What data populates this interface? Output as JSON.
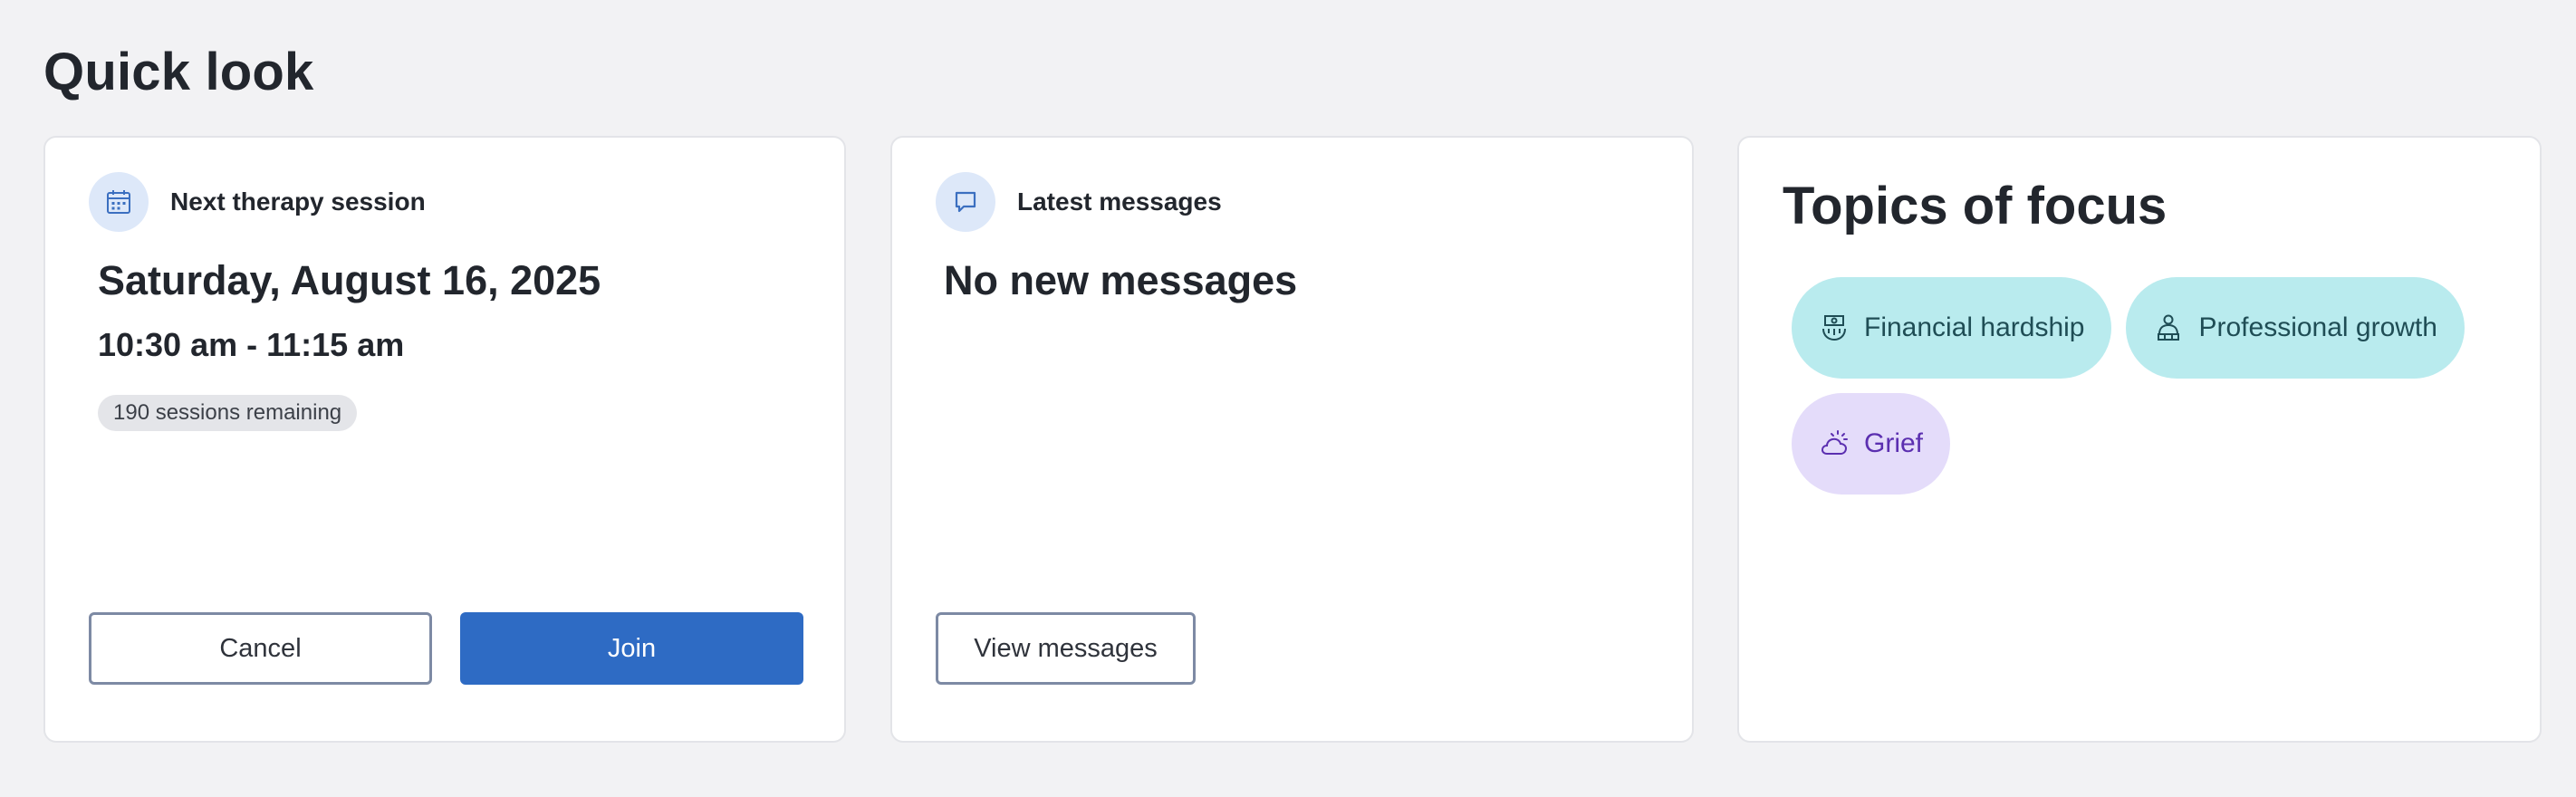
{
  "page": {
    "title": "Quick look"
  },
  "session_card": {
    "header": "Next therapy session",
    "icon": "calendar-icon",
    "date": "Saturday, August 16, 2025",
    "time": "10:30 am - 11:15 am",
    "badge": "190 sessions remaining",
    "cancel_label": "Cancel",
    "join_label": "Join"
  },
  "messages_card": {
    "header": "Latest messages",
    "icon": "chat-bubble-icon",
    "status": "No new messages",
    "view_label": "View messages"
  },
  "topics_card": {
    "title": "Topics of focus",
    "topics": [
      {
        "label": "Financial hardship",
        "icon": "money-hand-icon",
        "color": "#b9ebee"
      },
      {
        "label": "Professional growth",
        "icon": "person-growth-icon",
        "color": "#b9ebee"
      },
      {
        "label": "Grief",
        "icon": "cloud-sun-icon",
        "color": "#e4dcfa"
      }
    ]
  },
  "colors": {
    "accent": "#2e6bc4",
    "icon_bg": "#dde8f9",
    "chip_teal": "#b9ebee",
    "chip_purple": "#e4dcfa"
  }
}
